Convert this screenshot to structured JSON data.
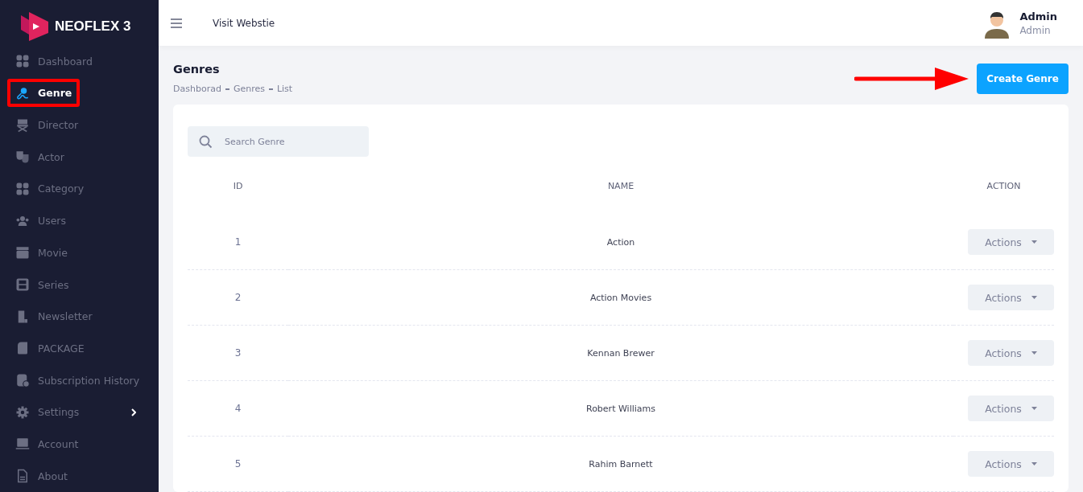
{
  "brand": {
    "name": "NEOFLEX 3"
  },
  "sidebar": {
    "items": [
      {
        "label": "Dashboard",
        "selected": false,
        "has_submenu": false
      },
      {
        "label": "Genre",
        "selected": true,
        "has_submenu": false
      },
      {
        "label": "Director",
        "selected": false,
        "has_submenu": false
      },
      {
        "label": "Actor",
        "selected": false,
        "has_submenu": false
      },
      {
        "label": "Category",
        "selected": false,
        "has_submenu": false
      },
      {
        "label": "Users",
        "selected": false,
        "has_submenu": false
      },
      {
        "label": "Movie",
        "selected": false,
        "has_submenu": false
      },
      {
        "label": "Series",
        "selected": false,
        "has_submenu": false
      },
      {
        "label": "Newsletter",
        "selected": false,
        "has_submenu": false
      },
      {
        "label": "PACKAGE",
        "selected": false,
        "has_submenu": false
      },
      {
        "label": "Subscription History",
        "selected": false,
        "has_submenu": false
      },
      {
        "label": "Settings",
        "selected": false,
        "has_submenu": true
      },
      {
        "label": "Account",
        "selected": false,
        "has_submenu": false
      },
      {
        "label": "About",
        "selected": false,
        "has_submenu": false
      }
    ]
  },
  "header": {
    "link": "Visit Webstie",
    "user_name": "Admin",
    "user_role": "Admin"
  },
  "page": {
    "title": "Genres",
    "breadcrumb": [
      "Dashborad",
      "Genres",
      "List"
    ],
    "create_button": "Create Genre"
  },
  "search": {
    "placeholder": "Search Genre"
  },
  "table": {
    "columns": [
      "ID",
      "NAME",
      "ACTION"
    ],
    "rows": [
      {
        "id": "1",
        "name": "Action",
        "action": "Actions"
      },
      {
        "id": "2",
        "name": "Action Movies",
        "action": "Actions"
      },
      {
        "id": "3",
        "name": "Kennan Brewer",
        "action": "Actions"
      },
      {
        "id": "4",
        "name": "Robert Williams",
        "action": "Actions"
      },
      {
        "id": "5",
        "name": "Rahim Barnett",
        "action": "Actions"
      }
    ]
  }
}
